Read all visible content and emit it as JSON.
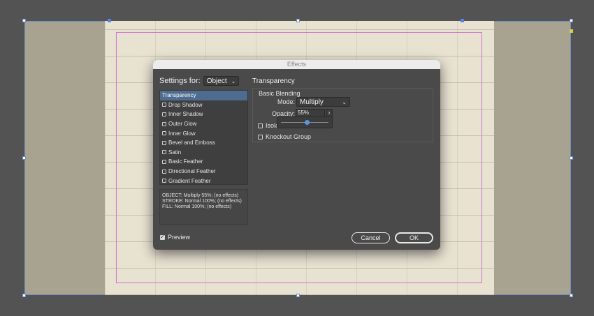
{
  "dialog": {
    "title": "Effects",
    "settings_for_label": "Settings for:",
    "settings_for_value": "Object",
    "effects_list": [
      {
        "label": "Transparency",
        "selected": true,
        "checkbox": false
      },
      {
        "label": "Drop Shadow",
        "selected": false,
        "checkbox": true
      },
      {
        "label": "Inner Shadow",
        "selected": false,
        "checkbox": true
      },
      {
        "label": "Outer Glow",
        "selected": false,
        "checkbox": true
      },
      {
        "label": "Inner Glow",
        "selected": false,
        "checkbox": true
      },
      {
        "label": "Bevel and Emboss",
        "selected": false,
        "checkbox": true
      },
      {
        "label": "Satin",
        "selected": false,
        "checkbox": true
      },
      {
        "label": "Basic Feather",
        "selected": false,
        "checkbox": true
      },
      {
        "label": "Directional Feather",
        "selected": false,
        "checkbox": true
      },
      {
        "label": "Gradient Feather",
        "selected": false,
        "checkbox": true
      }
    ],
    "summary": [
      "OBJECT: Multiply 55%; (no effects)",
      "STROKE: Normal 100%; (no effects)",
      "FILL: Normal 100%; (no effects)"
    ],
    "section_title": "Transparency",
    "basic_blending_title": "Basic Blending",
    "mode_label": "Mode:",
    "mode_value": "Multiply",
    "opacity_label": "Opacity:",
    "opacity_value": "55%",
    "opacity_arrow": "›",
    "opacity_fraction": 0.55,
    "isolate_label": "Isolat",
    "knockout_label": "Knockout Group",
    "preview_label": "Preview",
    "preview_checked": true,
    "cancel_label": "Cancel",
    "ok_label": "OK"
  },
  "icons": {
    "dropdown": "chevron-down-icon",
    "checkbox_checked": "checkmark-icon"
  },
  "colors": {
    "pasteboard": "#535353",
    "spread": "#a8a391",
    "selection_blue": "#4e6c8f",
    "slider_thumb": "#4f9ae8",
    "margin_guide": "#d372d6"
  }
}
